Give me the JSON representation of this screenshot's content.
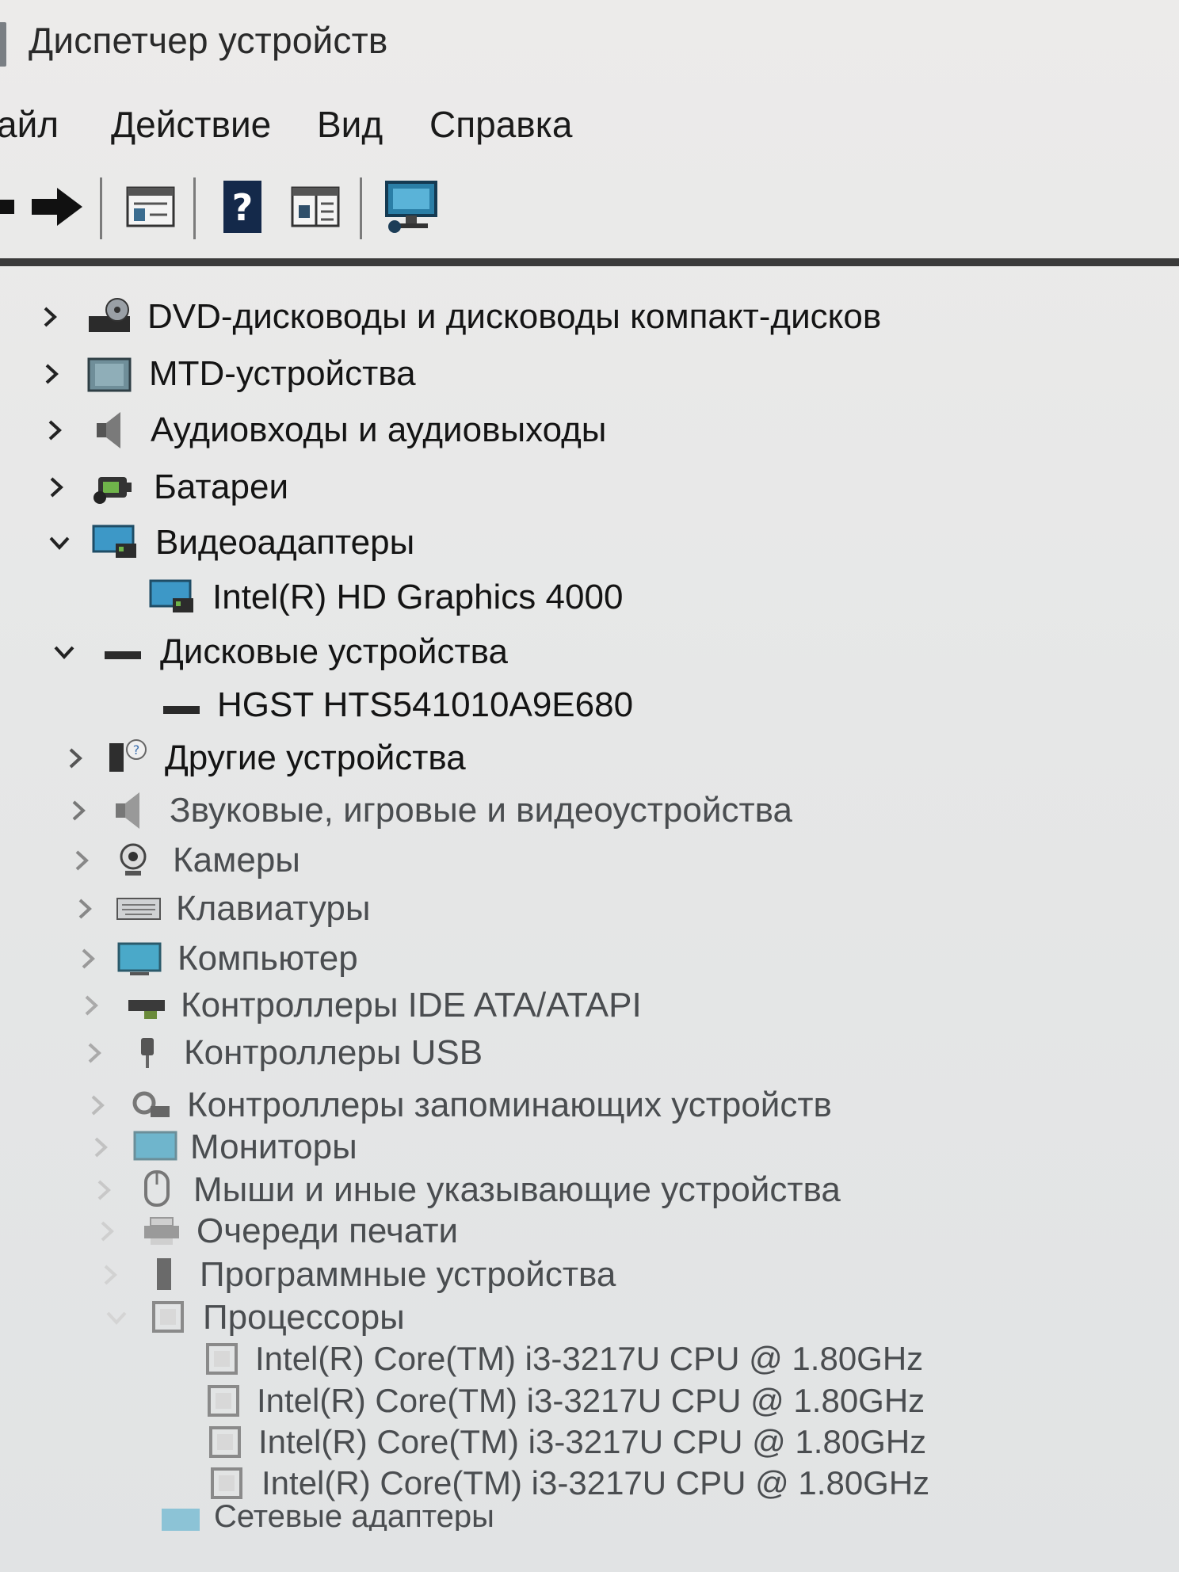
{
  "window": {
    "title": "Диспетчер устройств"
  },
  "menu": {
    "file": "айл",
    "action": "Действие",
    "view": "Вид",
    "help": "Справка"
  },
  "toolbar_icons": [
    "back-arrow-icon",
    "forward-arrow-icon",
    "properties-window-icon",
    "help-icon",
    "details-pane-icon",
    "monitor-scan-icon"
  ],
  "tree": [
    {
      "label": "DVD-дисководы и дисководы компакт-дисков",
      "state": "collapsed",
      "icon": "dvd-drive-icon"
    },
    {
      "label": "MTD-устройства",
      "state": "collapsed",
      "icon": "mtd-device-icon"
    },
    {
      "label": "Аудиовходы и аудиовыходы",
      "state": "collapsed",
      "icon": "speaker-icon"
    },
    {
      "label": "Батареи",
      "state": "collapsed",
      "icon": "battery-icon"
    },
    {
      "label": "Видеоадаптеры",
      "state": "expanded",
      "icon": "display-adapter-icon"
    },
    {
      "label": "Intel(R) HD Graphics 4000",
      "state": "child",
      "icon": "display-adapter-icon"
    },
    {
      "label": "Дисковые устройства",
      "state": "expanded",
      "icon": "disk-drive-icon"
    },
    {
      "label": "HGST HTS541010A9E680",
      "state": "child",
      "icon": "disk-drive-icon"
    },
    {
      "label": "Другие устройства",
      "state": "collapsed",
      "icon": "unknown-device-icon"
    },
    {
      "label": "Звуковые, игровые и видеоустройства",
      "state": "collapsed",
      "icon": "speaker-icon"
    },
    {
      "label": "Камеры",
      "state": "collapsed",
      "icon": "camera-icon"
    },
    {
      "label": "Клавиатуры",
      "state": "collapsed",
      "icon": "keyboard-icon"
    },
    {
      "label": "Компьютер",
      "state": "collapsed",
      "icon": "computer-icon"
    },
    {
      "label": "Контроллеры IDE ATA/ATAPI",
      "state": "collapsed",
      "icon": "ide-controller-icon"
    },
    {
      "label": "Контроллеры USB",
      "state": "collapsed",
      "icon": "usb-icon"
    },
    {
      "label": "Контроллеры запоминающих устройств",
      "state": "collapsed",
      "icon": "storage-controller-icon"
    },
    {
      "label": "Мониторы",
      "state": "collapsed",
      "icon": "monitor-icon"
    },
    {
      "label": "Мыши и иные указывающие устройства",
      "state": "collapsed",
      "icon": "mouse-icon"
    },
    {
      "label": "Очереди печати",
      "state": "collapsed",
      "icon": "printer-icon"
    },
    {
      "label": "Программные устройства",
      "state": "collapsed",
      "icon": "software-device-icon"
    },
    {
      "label": "Процессоры",
      "state": "expanded",
      "icon": "processor-icon"
    },
    {
      "label": "Intel(R) Core(TM) i3-3217U CPU @ 1.80GHz",
      "state": "child",
      "icon": "processor-icon"
    },
    {
      "label": "Intel(R) Core(TM) i3-3217U CPU @ 1.80GHz",
      "state": "child",
      "icon": "processor-icon"
    },
    {
      "label": "Intel(R) Core(TM) i3-3217U CPU @ 1.80GHz",
      "state": "child",
      "icon": "processor-icon"
    },
    {
      "label": "Intel(R) Core(TM) i3-3217U CPU @ 1.80GHz",
      "state": "child",
      "icon": "processor-icon"
    },
    {
      "label": "Сетевые адаптеры",
      "state": "collapsed",
      "icon": "network-adapter-icon"
    }
  ]
}
